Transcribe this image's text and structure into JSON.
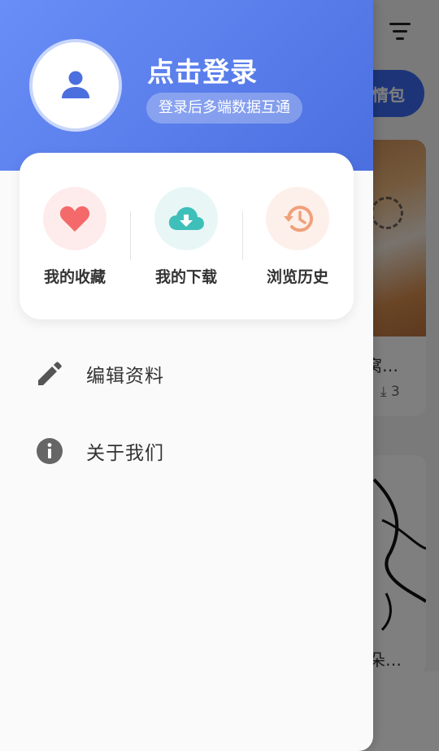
{
  "background": {
    "chip_label": "情包",
    "card1_title": "窝…",
    "card1_download_count": "3",
    "card2_title": "朵…"
  },
  "drawer": {
    "header": {
      "login_title": "点击登录",
      "login_subtitle": "登录后多端数据互通",
      "gradient_colors": [
        "#6a8ef7",
        "#4b6fdf"
      ]
    },
    "quick_actions": [
      {
        "label": "我的收藏",
        "icon": "heart-icon",
        "icon_color": "#f46a6a",
        "bg_color": "#fdeceb"
      },
      {
        "label": "我的下载",
        "icon": "cloud-download-icon",
        "icon_color": "#3fbfba",
        "bg_color": "#e8f7f6"
      },
      {
        "label": "浏览历史",
        "icon": "history-icon",
        "icon_color": "#f0a07a",
        "bg_color": "#fdf0ea"
      }
    ],
    "menu": [
      {
        "label": "编辑资料",
        "icon": "pencil-icon"
      },
      {
        "label": "关于我们",
        "icon": "info-icon"
      }
    ]
  }
}
